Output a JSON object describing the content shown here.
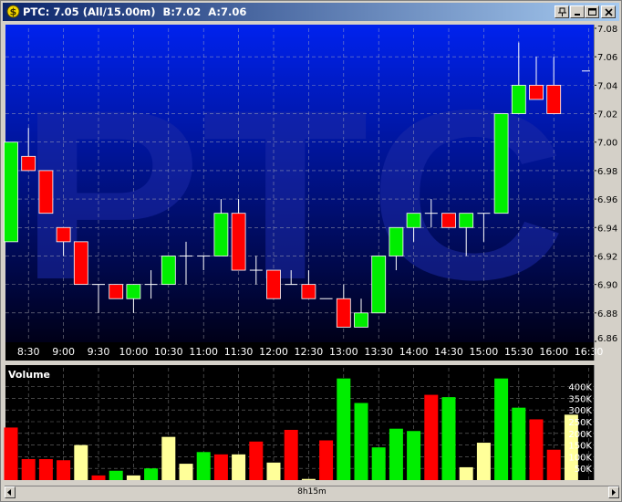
{
  "window": {
    "title": "PTC: 7.05 (All/15.00m)  B:7.02  A:7.06",
    "watermark": "PTC",
    "scroll_label": "8h15m"
  },
  "colors": {
    "up": "#00ee00",
    "down": "#ff0000",
    "neutral": "#ffff99",
    "price_bg_top": "#0022ee",
    "price_bg_bottom": "#000018",
    "volume_bg": "#000000",
    "grid": "#bbbbbb"
  },
  "chart_data": [
    {
      "type": "candlestick",
      "title": "",
      "x_tick_labels": [
        "8:30",
        "9:00",
        "9:30",
        "10:00",
        "10:30",
        "11:00",
        "11:30",
        "12:00",
        "12:30",
        "13:00",
        "13:30",
        "14:00",
        "14:30",
        "15:00",
        "15:30",
        "16:00",
        "16:30"
      ],
      "y_tick_labels": [
        "7.08",
        "7.06",
        "7.04",
        "7.02",
        "7.00",
        "6.98",
        "6.96",
        "6.94",
        "6.92",
        "6.90",
        "6.88",
        "6.86"
      ],
      "ylim": [
        6.86,
        7.08
      ],
      "last_price": 7.05,
      "candles": [
        {
          "t": "8:15",
          "o": 6.93,
          "h": 7.0,
          "l": 6.93,
          "c": 7.0
        },
        {
          "t": "8:30",
          "o": 6.99,
          "h": 7.01,
          "l": 6.98,
          "c": 6.98
        },
        {
          "t": "8:45",
          "o": 6.98,
          "h": 6.98,
          "l": 6.95,
          "c": 6.95
        },
        {
          "t": "9:00",
          "o": 6.94,
          "h": 6.94,
          "l": 6.92,
          "c": 6.93
        },
        {
          "t": "9:15",
          "o": 6.93,
          "h": 6.93,
          "l": 6.9,
          "c": 6.9
        },
        {
          "t": "9:30",
          "o": 6.9,
          "h": 6.9,
          "l": 6.88,
          "c": 6.9
        },
        {
          "t": "9:45",
          "o": 6.9,
          "h": 6.9,
          "l": 6.89,
          "c": 6.89
        },
        {
          "t": "10:00",
          "o": 6.89,
          "h": 6.9,
          "l": 6.88,
          "c": 6.9
        },
        {
          "t": "10:15",
          "o": 6.9,
          "h": 6.91,
          "l": 6.89,
          "c": 6.9
        },
        {
          "t": "10:30",
          "o": 6.9,
          "h": 6.92,
          "l": 6.9,
          "c": 6.92
        },
        {
          "t": "10:45",
          "o": 6.92,
          "h": 6.93,
          "l": 6.9,
          "c": 6.92
        },
        {
          "t": "11:00",
          "o": 6.92,
          "h": 6.92,
          "l": 6.91,
          "c": 6.92
        },
        {
          "t": "11:15",
          "o": 6.92,
          "h": 6.96,
          "l": 6.92,
          "c": 6.95
        },
        {
          "t": "11:30",
          "o": 6.95,
          "h": 6.96,
          "l": 6.91,
          "c": 6.91
        },
        {
          "t": "11:45",
          "o": 6.91,
          "h": 6.92,
          "l": 6.9,
          "c": 6.91
        },
        {
          "t": "12:00",
          "o": 6.91,
          "h": 6.91,
          "l": 6.89,
          "c": 6.89
        },
        {
          "t": "12:15",
          "o": 6.9,
          "h": 6.91,
          "l": 6.9,
          "c": 6.9
        },
        {
          "t": "12:30",
          "o": 6.9,
          "h": 6.91,
          "l": 6.89,
          "c": 6.89
        },
        {
          "t": "12:45",
          "o": 6.89,
          "h": 6.89,
          "l": 6.89,
          "c": 6.89
        },
        {
          "t": "13:00",
          "o": 6.89,
          "h": 6.9,
          "l": 6.87,
          "c": 6.87
        },
        {
          "t": "13:15",
          "o": 6.87,
          "h": 6.89,
          "l": 6.87,
          "c": 6.88
        },
        {
          "t": "13:30",
          "o": 6.88,
          "h": 6.92,
          "l": 6.88,
          "c": 6.92
        },
        {
          "t": "13:45",
          "o": 6.92,
          "h": 6.94,
          "l": 6.91,
          "c": 6.94
        },
        {
          "t": "14:00",
          "o": 6.94,
          "h": 6.95,
          "l": 6.93,
          "c": 6.95
        },
        {
          "t": "14:15",
          "o": 6.95,
          "h": 6.96,
          "l": 6.94,
          "c": 6.95
        },
        {
          "t": "14:30",
          "o": 6.95,
          "h": 6.95,
          "l": 6.94,
          "c": 6.94
        },
        {
          "t": "14:45",
          "o": 6.94,
          "h": 6.95,
          "l": 6.92,
          "c": 6.95
        },
        {
          "t": "15:00",
          "o": 6.95,
          "h": 6.95,
          "l": 6.93,
          "c": 6.95
        },
        {
          "t": "15:15",
          "o": 6.95,
          "h": 7.02,
          "l": 6.95,
          "c": 7.02
        },
        {
          "t": "15:30",
          "o": 7.02,
          "h": 7.07,
          "l": 7.02,
          "c": 7.04
        },
        {
          "t": "15:45",
          "o": 7.04,
          "h": 7.06,
          "l": 7.03,
          "c": 7.03
        },
        {
          "t": "16:00",
          "o": 7.04,
          "h": 7.06,
          "l": 7.02,
          "c": 7.02
        }
      ]
    },
    {
      "type": "bar",
      "title": "Volume",
      "y_tick_labels": [
        "400K",
        "350K",
        "300K",
        "250K",
        "200K",
        "150K",
        "100K",
        "50K"
      ],
      "ylim": [
        0,
        425000
      ],
      "values": [
        225000,
        90000,
        90000,
        85000,
        150000,
        20000,
        40000,
        20000,
        50000,
        185000,
        70000,
        120000,
        110000,
        110000,
        165000,
        75000,
        215000,
        5000,
        170000,
        435000,
        330000,
        140000,
        220000,
        210000,
        365000,
        355000,
        55000,
        160000,
        435000,
        310000,
        260000,
        130000,
        280000
      ],
      "bar_colors": [
        "down",
        "down",
        "down",
        "down",
        "neutral",
        "down",
        "up",
        "neutral",
        "up",
        "neutral",
        "neutral",
        "up",
        "down",
        "neutral",
        "down",
        "neutral",
        "down",
        "neutral",
        "down",
        "up",
        "up",
        "up",
        "up",
        "up",
        "down",
        "up",
        "neutral",
        "neutral",
        "up",
        "up",
        "down",
        "down",
        "neutral"
      ]
    }
  ]
}
